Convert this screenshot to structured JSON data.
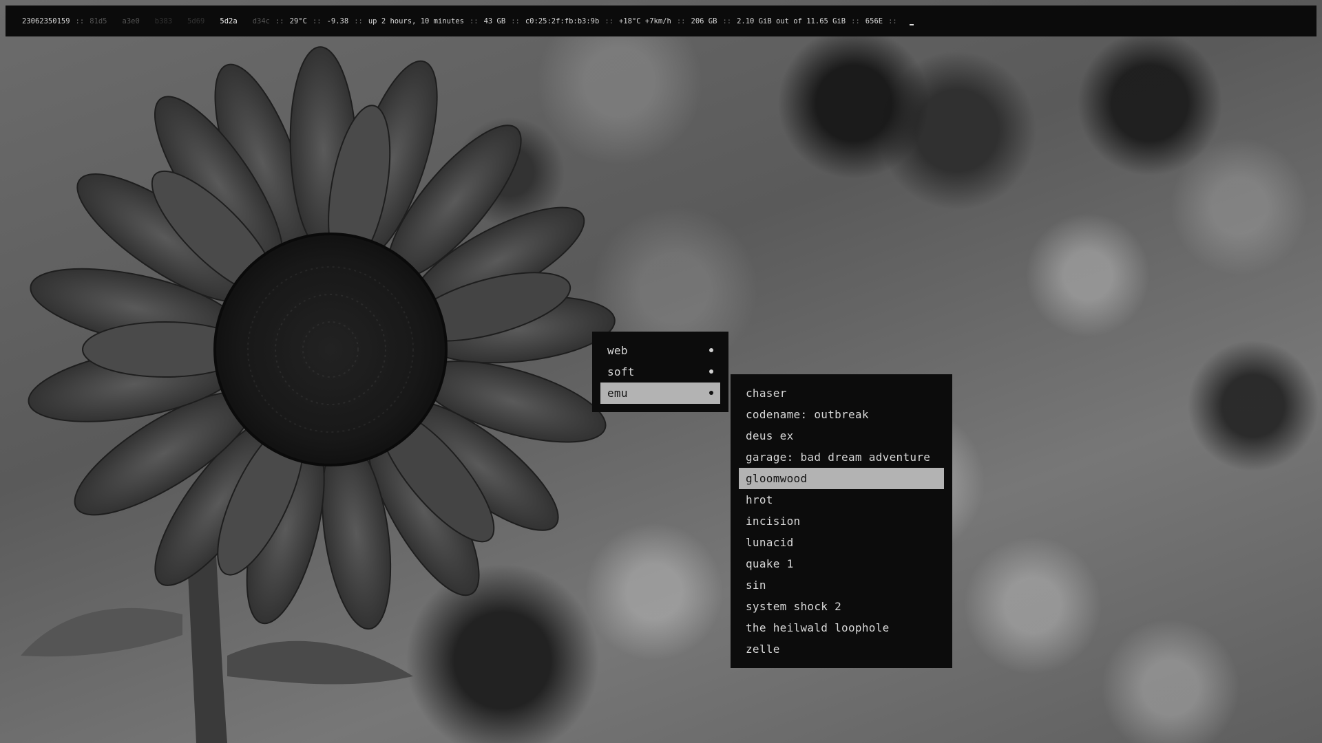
{
  "status_bar": {
    "date_id": "23062350159",
    "separator": "::",
    "workspaces": [
      {
        "label": "81d5",
        "state": "dim"
      },
      {
        "label": "a3e0",
        "state": "dim"
      },
      {
        "label": "b383",
        "state": "dimmer"
      },
      {
        "label": "5d69",
        "state": "dimmer"
      },
      {
        "label": "5d2a",
        "state": "active"
      },
      {
        "label": "d34c",
        "state": "dim"
      }
    ],
    "cpu_temp": "29°C",
    "load": "-9.38",
    "uptime": "up 2 hours, 10 minutes",
    "disk_root": "43 GB",
    "mac_address": "c0:25:2f:fb:b3:9b",
    "weather": "+18°C +7km/h",
    "disk_home": "206 GB",
    "memory": "2.10 GiB out of 11.65 GiB",
    "coords": "656E",
    "cursor": "_"
  },
  "menu": {
    "items": [
      {
        "label": "web"
      },
      {
        "label": "soft"
      },
      {
        "label": "emu"
      }
    ],
    "selected_index": 2
  },
  "submenu": {
    "items": [
      {
        "label": "chaser"
      },
      {
        "label": "codename: outbreak"
      },
      {
        "label": "deus ex"
      },
      {
        "label": "garage: bad dream adventure"
      },
      {
        "label": "gloomwood"
      },
      {
        "label": "hrot"
      },
      {
        "label": "incision"
      },
      {
        "label": "lunacid"
      },
      {
        "label": "quake 1"
      },
      {
        "label": "sin"
      },
      {
        "label": "system shock 2"
      },
      {
        "label": "the heilwald loophole"
      },
      {
        "label": "zelle"
      }
    ],
    "selected_index": 4
  },
  "colors": {
    "bar_bg": "#0b0b0b",
    "menu_bg": "#0c0c0c",
    "highlight": "#b3b3b3",
    "text": "#d8d8d8"
  }
}
